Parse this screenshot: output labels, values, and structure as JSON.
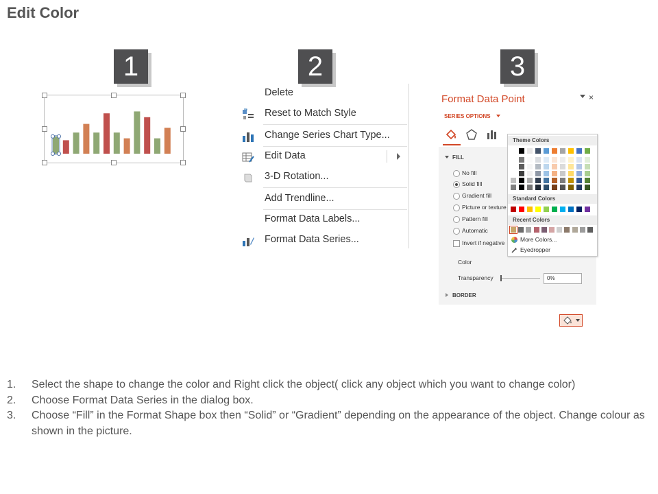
{
  "page": {
    "title": "Edit Color"
  },
  "steps": [
    "1",
    "2",
    "3"
  ],
  "thumbnail_chart": {
    "values": [
      18,
      14,
      22,
      31,
      22,
      42,
      22,
      16,
      44,
      38,
      16,
      27
    ],
    "colors": [
      "#8fa874",
      "#c0504d",
      "#8fa874",
      "#d28054",
      "#8fa874",
      "#c0504d",
      "#8fa874",
      "#d28054",
      "#8fa874",
      "#c0504d",
      "#8fa874",
      "#d28054"
    ]
  },
  "context_menu": {
    "items": [
      {
        "label": "Delete",
        "icon": "none",
        "disabled": false
      },
      {
        "label": "Reset to Match Style",
        "icon": "reset-style-icon",
        "disabled": false
      },
      {
        "label": "Change Series Chart Type...",
        "icon": "chart-type-icon",
        "disabled": false
      },
      {
        "label": "Edit Data",
        "icon": "edit-data-icon",
        "disabled": false,
        "submenu": true
      },
      {
        "label": "3-D Rotation...",
        "icon": "rotation-icon",
        "disabled": true
      },
      {
        "label": "Add Trendline...",
        "icon": "none",
        "disabled": true
      },
      {
        "label": "Format Data Labels...",
        "icon": "none",
        "disabled": false
      },
      {
        "label": "Format Data Series...",
        "icon": "format-series-icon",
        "disabled": false
      }
    ]
  },
  "format_pane": {
    "title": "Format Data Point",
    "close": "×",
    "series_options": "SERIES OPTIONS",
    "fill_header": "FILL",
    "fill_options": [
      {
        "label": "No fill",
        "checked": false
      },
      {
        "label": "Solid fill",
        "checked": true
      },
      {
        "label": "Gradient fill",
        "checked": false
      },
      {
        "label": "Picture or texture",
        "checked": false
      },
      {
        "label": "Pattern fill",
        "checked": false
      },
      {
        "label": "Automatic",
        "checked": false
      }
    ],
    "invert_label": "Invert if negative",
    "color_label": "Color",
    "transparency_label": "Transparency",
    "transparency_value": "0%",
    "border_header": "BORDER",
    "accent_color": "#d24726"
  },
  "color_picker": {
    "theme_header": "Theme Colors",
    "standard_header": "Standard Colors",
    "recent_header": "Recent Colors",
    "theme_colors": [
      "#ffffff",
      "#000000",
      "#e7e6e6",
      "#44546a",
      "#5b9bd5",
      "#ed7d31",
      "#a5a5a5",
      "#ffc000",
      "#4472c4",
      "#70ad47"
    ],
    "standard_colors": [
      "#c00000",
      "#ff0000",
      "#ffc000",
      "#ffff00",
      "#92d050",
      "#00b050",
      "#00b0f0",
      "#0070c0",
      "#002060",
      "#7030a0"
    ],
    "recent_colors": [
      "#c9a76a",
      "#6d6d6d",
      "#a5a5a5",
      "#b5646e",
      "#7b5f73",
      "#d4a5a5",
      "#cfcfcf",
      "#8c7a6b",
      "#b0a89a",
      "#9c9c9c",
      "#5f5f5f"
    ],
    "more_colors": "More Colors...",
    "eyedropper": "Eyedropper"
  },
  "instructions": [
    {
      "num": "1.",
      "text": "Select the shape to change the color and Right click the object( click any object which you want to change color)"
    },
    {
      "num": "2.",
      "text": "Choose Format Data Series in the dialog box."
    },
    {
      "num": "3.",
      "text": "Choose “Fill” in the Format Shape box then “Solid” or “Gradient” depending on the appearance of the object. Change colour as shown in the picture."
    }
  ]
}
